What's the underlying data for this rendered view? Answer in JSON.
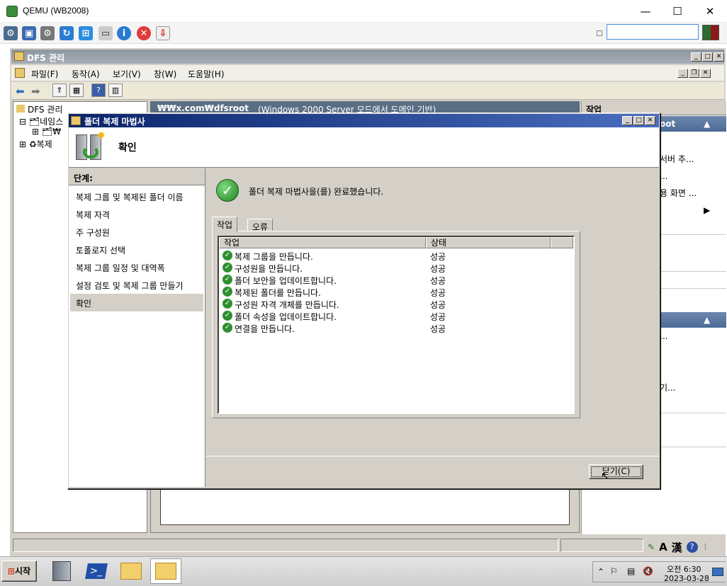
{
  "host": {
    "title": "QEMU (WB2008)",
    "minimize": "—",
    "maximize": "☐",
    "close": "✕"
  },
  "mmc": {
    "title": "DFS 관리",
    "menu": [
      "파일(F)",
      "동작(A)",
      "보기(V)",
      "창(W)",
      "도움말(H)"
    ]
  },
  "tree": {
    "root": "DFS 관리",
    "n1": "네임스",
    "n1a": "₩",
    "n2": "복제"
  },
  "center": {
    "path": "₩₩x.com₩dfsroot",
    "mode": "(Windows 2000 Server 모드에서 도메인 기반)"
  },
  "actions": {
    "header": "작업",
    "group1": "oot",
    "items1": [
      "서버 추...",
      "...",
      "용 화면 ..."
    ],
    "items2": [
      "...",
      "기..."
    ]
  },
  "wizard": {
    "title": "폴더 복제 마법사",
    "banner_title": "확인",
    "steps_header": "단계:",
    "steps": [
      "복제 그룹 및 복제된 폴더 이름",
      "복제 자격",
      "주 구성원",
      "토폴로지 선택",
      "복제 그룹 일정 및 대역폭",
      "설정 검토 및 복제 그룹 만들기",
      "확인"
    ],
    "complete_message": "폴더 복제 마법사을(를) 완료했습니다.",
    "tabs": [
      "작업",
      "오류"
    ],
    "columns": [
      "작업",
      "상태"
    ],
    "rows": [
      {
        "task": "복제 그룹을 만듭니다.",
        "status": "성공"
      },
      {
        "task": "구성원을 만듭니다.",
        "status": "성공"
      },
      {
        "task": "폴더 보안을 업데이트합니다.",
        "status": "성공"
      },
      {
        "task": "복제된 폴더를 만듭니다.",
        "status": "성공"
      },
      {
        "task": "구성원 자격 개체를 만듭니다.",
        "status": "성공"
      },
      {
        "task": "폴더 속성을 업데이트합니다.",
        "status": "성공"
      },
      {
        "task": "연결을 만듭니다.",
        "status": "성공"
      }
    ],
    "close_button": "닫기(C)"
  },
  "taskbar": {
    "start": "시작",
    "lang": "A",
    "han": "漢",
    "time": "오전 6:30",
    "date": "2023-03-28"
  },
  "colors": {
    "wizard_title": "#0a246a",
    "success": "#2f8f2f",
    "action_header": "#4c6b97"
  }
}
